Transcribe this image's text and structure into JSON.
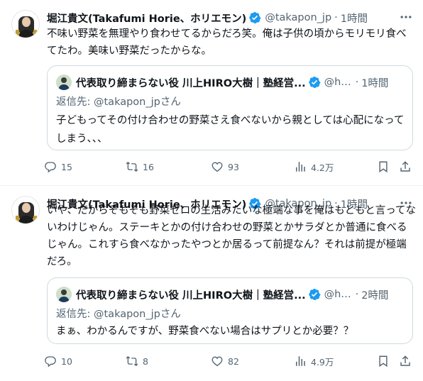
{
  "tweets": [
    {
      "author": {
        "name": "堀江貴文(Takafumi Horie、ホリエモン)",
        "handle": "@takapon_jp",
        "dot": "·",
        "time": "1時間"
      },
      "text": "不味い野菜を無理やり食わせてるからだろ笑。俺は子供の頃からモリモリ食べてたわ。美味い野菜だったからな。",
      "quote": {
        "name": "代表取り締まらない役 川上HIRO大樹｜塾経営...",
        "handle": "@hiro...",
        "dot": "·",
        "time": "1時間",
        "reply_to": "返信先: @takapon_jpさん",
        "text": "子どもってその付け合わせの野菜さえ食べないから親としては心配になってしまう、、、"
      },
      "stats": {
        "replies": "15",
        "reposts": "16",
        "likes": "93",
        "views": "4.2万"
      }
    },
    {
      "author": {
        "name": "堀江貴文(Takafumi Horie、ホリエモン)",
        "handle": "@takapon_jp",
        "dot": "·",
        "time": "1時間"
      },
      "text": "いや、だからそもそも野菜ゼロの生活みたいな極端な事を俺はもともと言ってないわけじゃん。ステーキとかの付け合わせの野菜とかサラダとか普通に食べるじゃん。これすら食べなかったやつとか居るって前提なん？それは前提が極端だろ。",
      "quote": {
        "name": "代表取り締まらない役 川上HIRO大樹｜塾経営...",
        "handle": "@hiro...",
        "dot": "·",
        "time": "2時間",
        "reply_to": "返信先: @takapon_jpさん",
        "text": "まぁ、わかるんですが、野菜食べない場合はサプリとか必要？？"
      },
      "stats": {
        "replies": "10",
        "reposts": "8",
        "likes": "82",
        "views": "4.9万"
      }
    }
  ],
  "icons": {
    "verified": "verified-badge-icon",
    "more": "more-icon",
    "reply": "reply-icon",
    "repost": "repost-icon",
    "like": "heart-icon",
    "views": "views-icon",
    "bookmark": "bookmark-icon",
    "share": "share-icon"
  },
  "colors": {
    "text": "#0f1419",
    "secondary": "#536471",
    "verified": "#1d9bf0",
    "border": "#cfd9de"
  }
}
